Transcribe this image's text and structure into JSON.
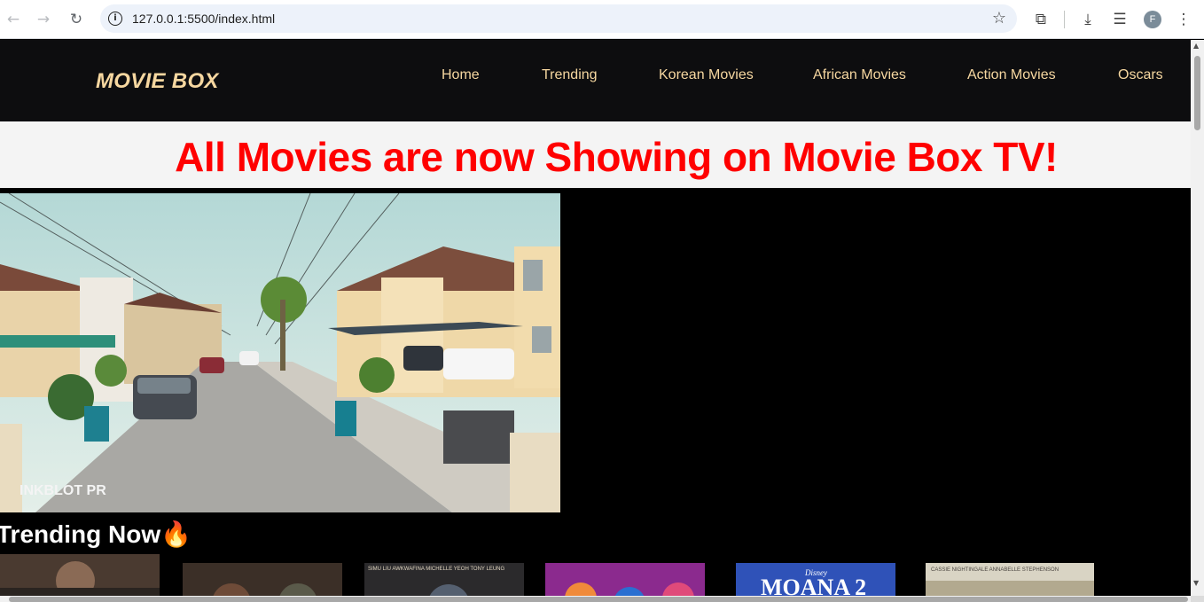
{
  "browser": {
    "url": "127.0.0.1:5500/index.html",
    "avatar_letter": "F",
    "back_icon": "←",
    "forward_icon": "→",
    "reload_icon": "↻",
    "info_icon": "i",
    "star_icon": "☆",
    "extensions_icon": "⧉",
    "download_icon": "⤓",
    "media_icon": "☰",
    "menu_icon": "⋮"
  },
  "site": {
    "logo": "MOVIE BOX",
    "nav": [
      "Home",
      "Trending",
      "Korean Movies",
      "African Movies",
      "Action Movies",
      "Oscars"
    ],
    "banner": "All Movies are now Showing on Movie Box TV!",
    "video_watermark": "INKBLOT PR",
    "trending_title": "Trending Now🔥",
    "posters": [
      {
        "credits": ""
      },
      {
        "credits": ""
      },
      {
        "credits": "SIMU LIU   AWKWAFINA   MICHELLE YEOH   TONY LEUNG"
      },
      {
        "credits": ""
      },
      {
        "credits": "Disney",
        "title": "MOANA 2"
      },
      {
        "credits": "CASSIE NIGHTINGALE   ANNABELLE STEPHENSON"
      }
    ]
  },
  "colors": {
    "accent": "#f6d7a0",
    "banner_text": "#ff0000",
    "nav_bg": "#0d0d0f"
  }
}
